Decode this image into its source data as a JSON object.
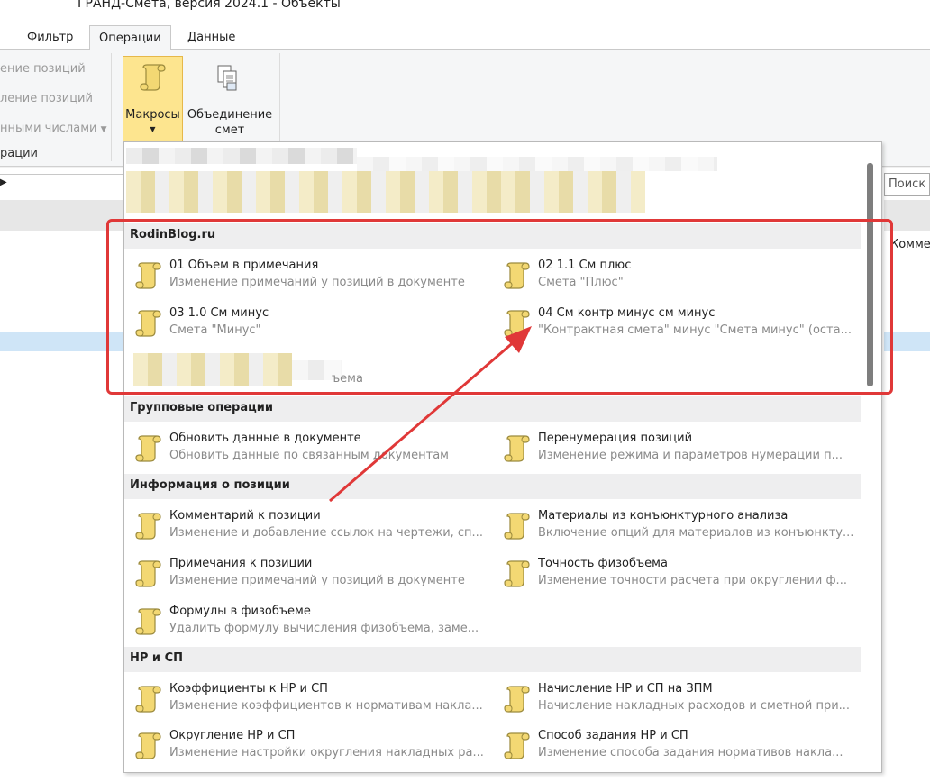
{
  "window": {
    "title": "ГРАНД-Смета, версия 2024.1 - Объекты"
  },
  "tabs": [
    {
      "label": "Фильтр",
      "active": false
    },
    {
      "label": "Операции",
      "active": true
    },
    {
      "label": "Данные",
      "active": false
    }
  ],
  "ribbon": {
    "left_items": [
      "ение позиций",
      "ление позиций",
      "нными числами"
    ],
    "group_label": "рации",
    "macros_label": "Макросы",
    "merge_label_1": "Объединение",
    "merge_label_2": "смет"
  },
  "search": {
    "placeholder": "Поиск"
  },
  "column_header_partial": "Комме",
  "sections": [
    {
      "title": "RodinBlog.ru",
      "items": [
        {
          "title": "01 Объем в примечания",
          "desc": "Изменение примечаний у позиций в документе"
        },
        {
          "title": "02 1.1 См плюс",
          "desc": "Смета \"Плюс\""
        },
        {
          "title": "03 1.0 См минус",
          "desc": "Смета \"Минус\""
        },
        {
          "title": "04 См контр минус см минус",
          "desc": "\"Контрактная смета\" минус \"Смета минус\" (оста..."
        }
      ],
      "partial_desc": "ъема"
    },
    {
      "title": "Групповые операции",
      "items": [
        {
          "title": "Обновить данные в документе",
          "desc": "Обновить данные по связанным документам"
        },
        {
          "title": "Перенумерация позиций",
          "desc": "Изменение режима и параметров нумерации п..."
        }
      ]
    },
    {
      "title": "Информация о позиции",
      "items": [
        {
          "title": "Комментарий к позиции",
          "desc": "Изменение и добавление ссылок на чертежи, сп..."
        },
        {
          "title": "Материалы из конъюнктурного анализа",
          "desc": "Включение опций для материалов из конъюнкту..."
        },
        {
          "title": "Примечания к позиции",
          "desc": "Изменение примечаний у позиций в документе"
        },
        {
          "title": "Точность физобъема",
          "desc": "Изменение точности расчета при округлении ф..."
        },
        {
          "title": "Формулы в физобъеме",
          "desc": "Удалить формулу вычисления физобъема, заме..."
        }
      ]
    },
    {
      "title": "НР и СП",
      "items": [
        {
          "title": "Коэффициенты к НР и СП",
          "desc": "Изменение коэффициентов к нормативам накла..."
        },
        {
          "title": "Начисление НР и СП на ЗПМ",
          "desc": "Начисление накладных расходов и сметной при..."
        },
        {
          "title": "Округление НР и СП",
          "desc": "Изменение настройки округления накладных ра..."
        },
        {
          "title": "Способ задания НР и СП",
          "desc": "Изменение способа задания нормативов накла..."
        }
      ]
    }
  ],
  "colors": {
    "highlight": "#e03838",
    "macro_button": "#fde58f",
    "icon": "#f1d36a"
  }
}
